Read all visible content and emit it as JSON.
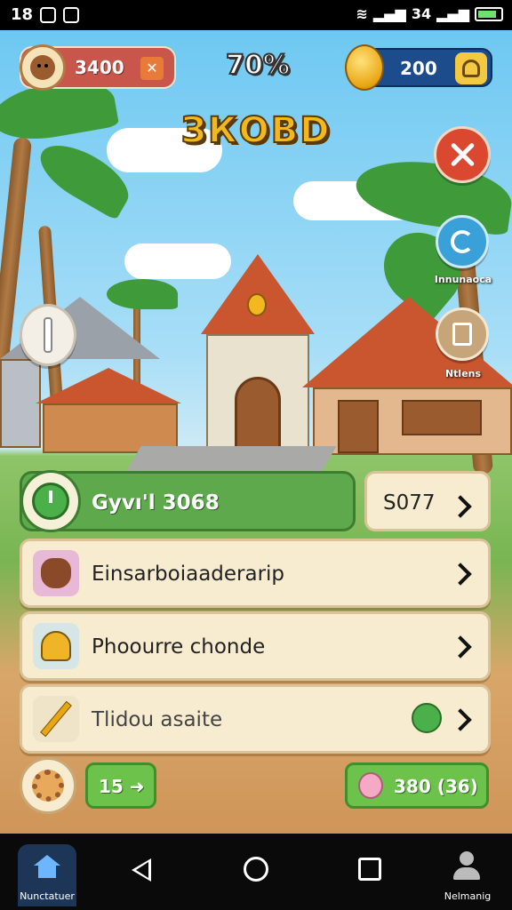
{
  "status_bar": {
    "time": "18",
    "right_text": "34"
  },
  "hud": {
    "player_score": "3400",
    "progress": "70%",
    "coins": "200"
  },
  "game_title": "ЗКОВD",
  "side_buttons": {
    "redo_label": "Innunaoca",
    "note_label": "Ntlens"
  },
  "daily": {
    "label": "Gyvı'l 3068",
    "value": "S077"
  },
  "menu": [
    {
      "label": "Einsarboiaaderarip",
      "icon": "bear-icon"
    },
    {
      "label": "Phoourre chonde",
      "icon": "bell-icon"
    },
    {
      "label": "Tlidou asaite",
      "icon": "pencil-icon"
    }
  ],
  "bottom_bar": {
    "left_pill": "15 ➜",
    "right_pill": "380 (36)"
  },
  "nav": {
    "home_label": "Nunctatuer",
    "profile_label": "Nelmanig"
  },
  "colors": {
    "sky": "#6ec8f2",
    "grass": "#79b552",
    "accent_green": "#5fa94d",
    "accent_red": "#d9482f",
    "coin_bar": "#1d4c8c"
  }
}
